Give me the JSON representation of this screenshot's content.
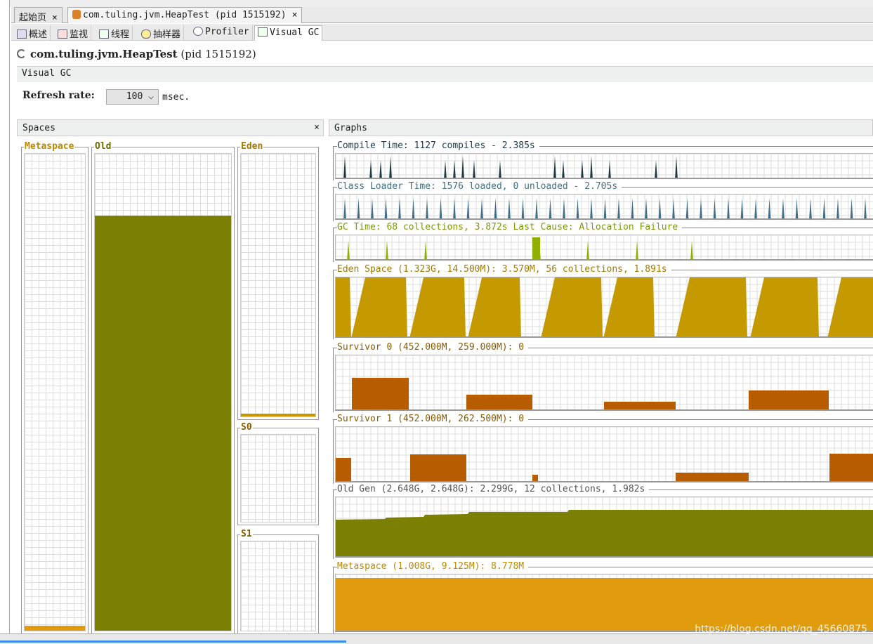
{
  "tabs": [
    {
      "label": "起始页",
      "close": "×"
    },
    {
      "label": "com.tuling.jvm.HeapTest (pid 1515192)",
      "close": "×"
    }
  ],
  "subtabs": [
    {
      "label": "概述",
      "icon": "overview-icon"
    },
    {
      "label": "监视",
      "icon": "monitor-icon"
    },
    {
      "label": "线程",
      "icon": "threads-icon"
    },
    {
      "label": "抽样器",
      "icon": "sampler-icon"
    },
    {
      "label": "Profiler",
      "icon": "profiler-icon"
    },
    {
      "label": "Visual GC",
      "icon": "visualgc-icon"
    }
  ],
  "app": {
    "name": "com.tuling.jvm.HeapTest",
    "pid": "(pid 1515192)"
  },
  "panel_title": "Visual GC",
  "refresh": {
    "label": "Refresh rate:",
    "value": "100",
    "unit": "msec."
  },
  "spaces": {
    "title": "Spaces",
    "close": "×",
    "metaspace": "Metaspace",
    "old": "Old",
    "eden": "Eden",
    "s0": "S0",
    "s1": "S1",
    "fill": {
      "metaspace": 0.01,
      "old": 0.87,
      "eden": 0.01,
      "s0": 0,
      "s1": 0
    }
  },
  "graphs": {
    "title": "Graphs",
    "compile": "Compile Time: 1127 compiles - 2.385s",
    "classloader": "Class Loader Time: 1576 loaded, 0 unloaded - 2.705s",
    "gc": "GC Time: 68 collections, 3.872s  Last Cause: Allocation Failure",
    "eden": "Eden Space (1.323G, 14.500M): 3.570M, 56 collections, 1.891s",
    "s0": "Survivor 0 (452.000M, 259.000M): 0",
    "s1": "Survivor 1 (452.000M, 262.500M): 0",
    "oldgen": "Old Gen (2.648G, 2.648G): 2.299G, 12 collections, 1.982s",
    "metaspace": "Metaspace (1.008G, 9.125M): 8.778M"
  },
  "colors": {
    "compile": "#1f3a44",
    "classloader": "#3f6f86",
    "gc": "#8fb000",
    "eden": "#c49a00",
    "survivor": "#b85c00",
    "old": "#7b8004",
    "metaspace": "#e09c0c",
    "label_old": "#6a6a00"
  },
  "watermark": "https://blog.csdn.net/qq_45660875"
}
